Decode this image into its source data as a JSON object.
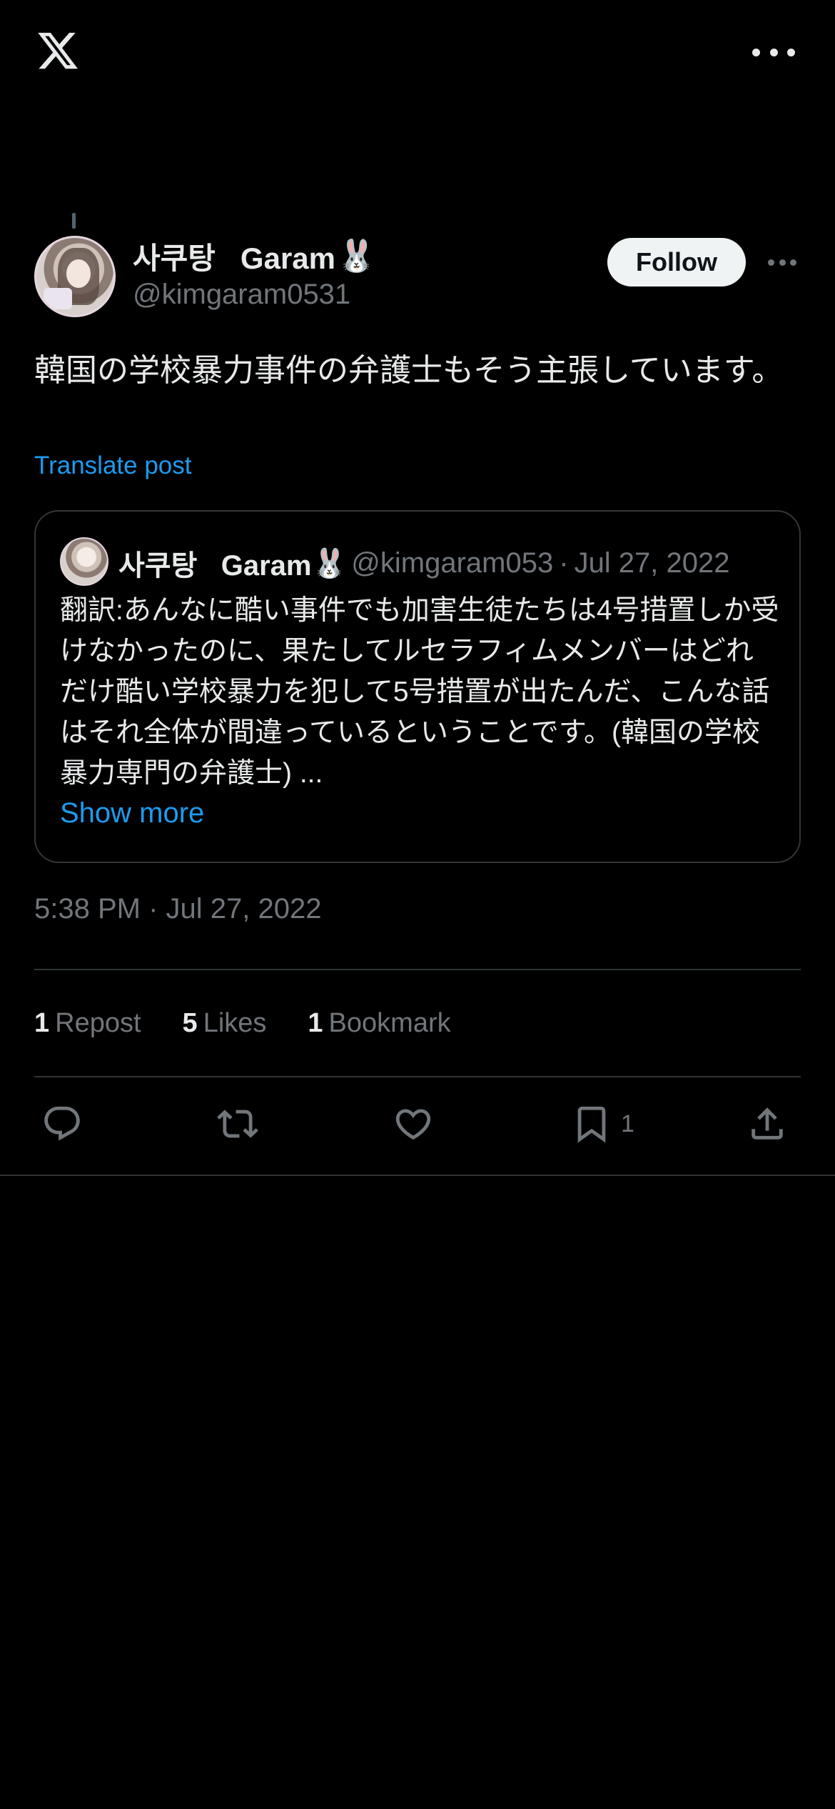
{
  "app": {
    "logo_icon": "x-logo-icon"
  },
  "post": {
    "display_name": "사쿠탕   Garam",
    "name_emoji": "🐰",
    "handle": "@kimgaram0531",
    "follow_label": "Follow",
    "text": "韓国の学校暴力事件の弁護士もそう主張しています。",
    "translate_label": "Translate post",
    "timestamp": "5:38 PM · Jul 27, 2022"
  },
  "quote": {
    "display_name": "사쿠탕   Garam",
    "name_emoji": "🐰",
    "handle": "@kimgaram053",
    "separator": "·",
    "date": "Jul 27, 2022",
    "text": "翻訳:あんなに酷い事件でも加害生徒たちは4号措置しか受けなかったのに、果たしてルセラフィムメンバーはどれだけ酷い学校暴力を犯して5号措置が出たんだ、こんな話はそれ全体が間違っているということです。(韓国の学校暴力専門の弁護士) ...",
    "show_more_label": "Show more"
  },
  "stats": {
    "reposts": {
      "count": "1",
      "label": "Repost"
    },
    "likes": {
      "count": "5",
      "label": "Likes"
    },
    "bookmarks": {
      "count": "1",
      "label": "Bookmark"
    }
  },
  "actions": {
    "reply_icon": "reply-icon",
    "repost_icon": "repost-icon",
    "like_icon": "heart-icon",
    "bookmark_icon": "bookmark-icon",
    "bookmark_count": "1",
    "share_icon": "share-icon"
  },
  "colors": {
    "background": "#000000",
    "text": "#e7e9ea",
    "muted": "#71767b",
    "link": "#1d9bf0",
    "border": "#2f3336"
  }
}
